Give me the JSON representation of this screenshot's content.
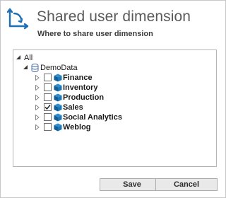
{
  "header": {
    "title": "Shared user dimension",
    "subtitle": "Where to share user dimension",
    "icon": "axis-chart-icon",
    "accent_color": "#1f6fb5"
  },
  "tree": {
    "root": {
      "label": "All",
      "expanded": true
    },
    "database": {
      "label": "DemoData",
      "icon": "database-icon",
      "expanded": true
    },
    "items": [
      {
        "label": "Finance",
        "checked": false,
        "icon": "cube-icon"
      },
      {
        "label": "Inventory",
        "checked": false,
        "icon": "cube-icon"
      },
      {
        "label": "Production",
        "checked": false,
        "icon": "cube-icon"
      },
      {
        "label": "Sales",
        "checked": true,
        "icon": "cube-icon"
      },
      {
        "label": "Social Analytics",
        "checked": false,
        "icon": "cube-icon"
      },
      {
        "label": "Weblog",
        "checked": false,
        "icon": "cube-icon"
      }
    ]
  },
  "buttons": {
    "save_label": "Save",
    "cancel_label": "Cancel"
  }
}
